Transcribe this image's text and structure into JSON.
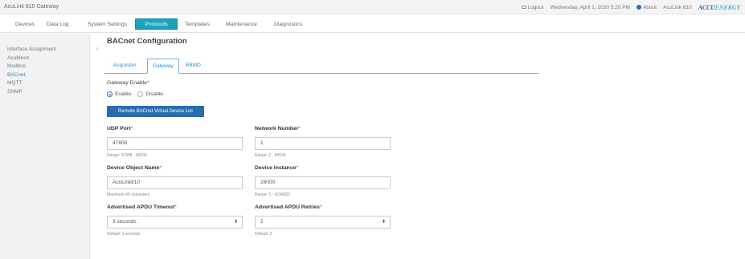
{
  "app": {
    "title": "AcuLink 810 Gateway"
  },
  "top_right": {
    "logout": "Logout",
    "datetime": "Wednesday, April 1, 2020 5:20 PM",
    "about": "About",
    "device_name": "AcuLink 810",
    "logo_text_a": "ACCU",
    "logo_text_b": "ENERGY"
  },
  "nav": {
    "items": [
      "Devices",
      "Data Log",
      "System Settings",
      "Protocols",
      "Templates",
      "Maintenance",
      "Diagnostics"
    ],
    "active": "Protocols"
  },
  "sidebar": {
    "items": [
      "Interface Assignment",
      "AcuMesh",
      "Modbus",
      "BACnet",
      "MQTT",
      "SNMP"
    ],
    "active": "BACnet"
  },
  "page": {
    "title": "BACnet Configuration"
  },
  "tabs": {
    "items": [
      "Acquisitor",
      "Gateway",
      "BBMD"
    ],
    "active": "Gateway"
  },
  "form": {
    "gateway_enable": {
      "label": "Gateway Enable",
      "required_mark": "*",
      "options": [
        "Enable",
        "Disable"
      ],
      "selected": "Enable"
    },
    "remote_button": "Remote BACnet Virtual Device List",
    "udp_port": {
      "label": "UDP Port",
      "required_mark": "*",
      "value": "47808",
      "hint": "Range: 47808 - 49000"
    },
    "network_number": {
      "label": "Network Number",
      "required_mark": "*",
      "value": "1",
      "hint": "Range: 1 - 65534"
    },
    "device_object_name": {
      "label": "Device Object Name",
      "required_mark": "*",
      "value": "AcuLink810",
      "hint": "Maximum 40 characters"
    },
    "device_instance": {
      "label": "Device Instance",
      "required_mark": "*",
      "value": "26000",
      "hint": "Range: 0 - 4194302"
    },
    "apdu_timeout": {
      "label": "Advertised APDU Timeout",
      "required_mark": "*",
      "value": "3 seconds",
      "hint": "Default: 3 seconds"
    },
    "apdu_retries": {
      "label": "Advertised APDU Retries",
      "required_mark": "*",
      "value": "2",
      "hint": "Default: 2"
    }
  },
  "colors": {
    "accent": "#1ba3b7",
    "primary_button": "#2a6cb0",
    "link": "#2c8fc4",
    "required": "#dd3333"
  }
}
